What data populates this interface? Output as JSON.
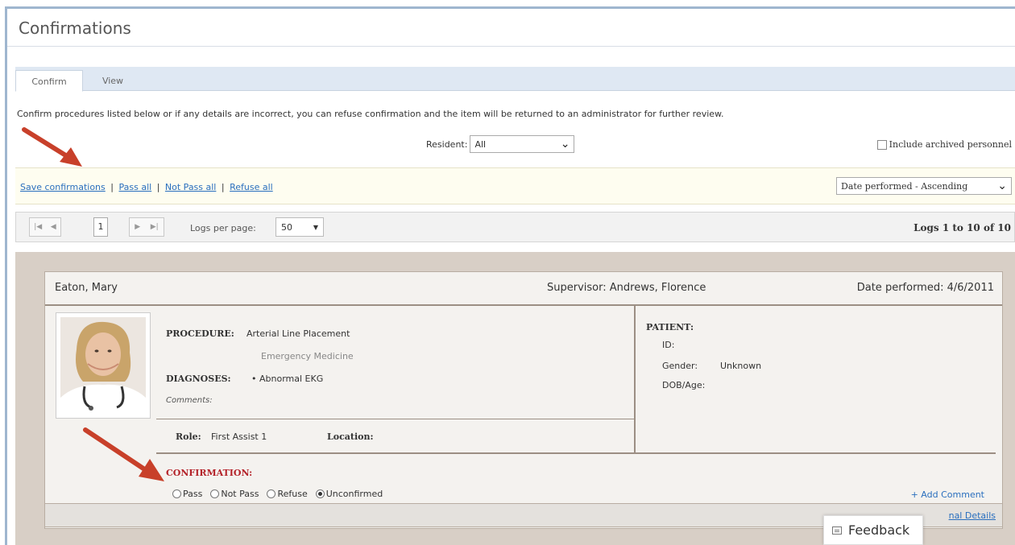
{
  "page": {
    "title": "Confirmations"
  },
  "tabs": [
    {
      "label": "Confirm",
      "active": true
    },
    {
      "label": "View",
      "active": false
    }
  ],
  "intro_text": "Confirm procedures listed below or if any details are incorrect, you can refuse confirmation and the item will be returned to an administrator for further review.",
  "filters": {
    "resident_label": "Resident:",
    "resident_value": "All",
    "archived_label": "Include archived personnel",
    "archived_checked": false
  },
  "actions": {
    "save": "Save confirmations",
    "sep1": "|",
    "pass_all": "Pass all",
    "sep2": "|",
    "not_pass_all": "Not Pass all",
    "sep3": "|",
    "refuse_all": "Refuse all",
    "sort_value": "Date performed - Ascending"
  },
  "pager": {
    "page_number": "1",
    "logs_per_page_label": "Logs per page:",
    "logs_per_page_value": "50",
    "logs_count": "Logs 1 to 10 of 10"
  },
  "log": {
    "name": "Eaton, Mary",
    "supervisor": "Supervisor: Andrews, Florence",
    "date_performed": "Date performed: 4/6/2011",
    "procedure_label": "PROCEDURE:",
    "procedure_value": "Arterial Line Placement",
    "procedure_specialty": "Emergency Medicine",
    "diagnoses_label": "DIAGNOSES:",
    "diagnoses_value": "• Abnormal EKG",
    "comments_label": "Comments:",
    "role_label": "Role:",
    "role_value": "First Assist 1",
    "location_label": "Location:",
    "patient_label": "PATIENT:",
    "patient_id_label": "ID:",
    "patient_gender_label": "Gender:",
    "patient_gender_value": "Unknown",
    "patient_dob_label": "DOB/Age:",
    "confirmation_label": "CONFIRMATION:",
    "options": [
      "Pass",
      "Not Pass",
      "Refuse",
      "Unconfirmed"
    ],
    "selected_option": "Unconfirmed",
    "add_comment": "+ Add Comment",
    "additional_details": "nal Details"
  },
  "feedback": {
    "label": "Feedback"
  },
  "colors": {
    "link": "#2a6fbe",
    "confirmation_red": "#b4232a",
    "arrow_red": "#c8402a",
    "tabbar": "#dfe8f3",
    "card_bg": "#d8cfc6"
  }
}
